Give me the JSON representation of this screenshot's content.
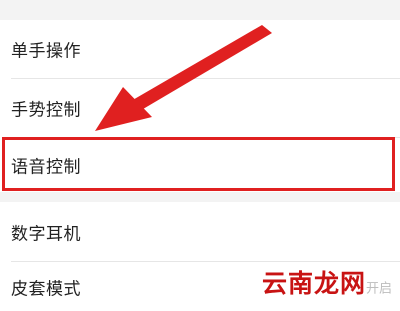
{
  "settings": {
    "items": [
      {
        "label": "单手操作"
      },
      {
        "label": "手势控制"
      },
      {
        "label": "语音控制"
      },
      {
        "label": "数字耳机"
      },
      {
        "label": "皮套模式",
        "state": "开启"
      }
    ]
  },
  "annotation": {
    "color": "#e02020",
    "arrow_icon": "red-arrow-icon",
    "highlight_target": "语音控制"
  },
  "watermark": {
    "text": "云南龙网"
  }
}
